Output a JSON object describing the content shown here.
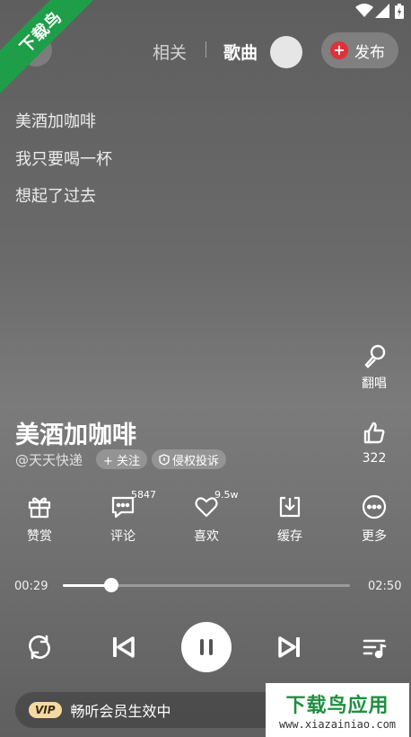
{
  "watermark": {
    "ribbon_text": "下载鸟",
    "brand_text": "下载鸟应用",
    "brand_url": "www.xiazainiao.com",
    "brand_color": "#1f8f3f"
  },
  "tabs": {
    "related": "相关",
    "songs": "歌曲"
  },
  "publish": {
    "label": "发布",
    "icon": "plus-icon",
    "icon_color": "#e0313a"
  },
  "lyrics": [
    "美酒加咖啡",
    "我只要喝一杯",
    "想起了过去"
  ],
  "side_actions": {
    "cover": {
      "label": "翻唱",
      "icon": "microphone-icon"
    },
    "like": {
      "count": "322",
      "icon": "thumbs-up-icon"
    }
  },
  "song": {
    "title": "美酒加咖啡",
    "artist": "@天天快递",
    "follow_label": "+ 关注",
    "report_label": "侵权投诉"
  },
  "actions": [
    {
      "label": "赞赏",
      "icon": "gift-icon",
      "badge": ""
    },
    {
      "label": "评论",
      "icon": "comment-icon",
      "badge": "5847"
    },
    {
      "label": "喜欢",
      "icon": "heart-icon",
      "badge": "9.5w"
    },
    {
      "label": "缓存",
      "icon": "download-icon",
      "badge": ""
    },
    {
      "label": "更多",
      "icon": "more-icon",
      "badge": ""
    }
  ],
  "progress": {
    "elapsed": "00:29",
    "total": "02:50",
    "fraction": 0.17
  },
  "controls": {
    "loop": "repeat-icon",
    "prev": "previous-icon",
    "play": "pause-icon",
    "next": "next-icon",
    "playlist": "playlist-icon"
  },
  "vip": {
    "tag": "VIP",
    "text": "畅听会员生效中",
    "tag_color": "#f5d9a3"
  }
}
